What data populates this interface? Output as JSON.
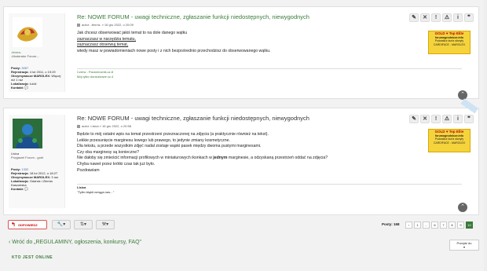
{
  "post1": {
    "user": "-fenrra-",
    "rank": "-Moderator Forum-..",
    "fields": [
      {
        "k": "Posty:",
        "v": "3057"
      },
      {
        "k": "Rejestracja:",
        "v": "4 lut 2011, o 19:29"
      },
      {
        "k": "Otrzymywacze MAROLEX:",
        "v": "Więcej niż 1 raz"
      },
      {
        "k": "Lokalizacja:",
        "v": "Łódź"
      },
      {
        "k": "Kontakt:",
        "v": ""
      }
    ],
    "title": "Re: NOWE FORUM - uwagi techniczne, zgłaszanie funkcji niedostępnych, niewygodnych",
    "meta": "autor: -fenrra- » 16 gru 2022, o 20:09",
    "body": [
      "Jak chcesz obserwować jakiś temat to na dole danego wątku",
      "zaznaczasz w narzędzia tematu,",
      "zaznaczasz obserwuj temat,",
      "wtedy masz w powiadomieniach nowe posty i z nich bezpośrednio przechodzisz do obserwowanego wątku."
    ],
    "sig": [
      "Czerw - Paciorecznik.cz.8",
      "Mój tylko doniczkowe cz.4"
    ]
  },
  "post2": {
    "user": "Lisica",
    "rank": "Przyjaciel Forum - gold",
    "fields": [
      {
        "k": "Posty:",
        "v": "1332"
      },
      {
        "k": "Rejestracja:",
        "v": "18 lut 2012, o 18:27"
      },
      {
        "k": "Otrzymywacze MAROLEX:",
        "v": "3 raz"
      },
      {
        "k": "Lokalizacja:",
        "v": "Gdańsk i Ziemia Kaszubska"
      },
      {
        "k": "Kontakt:",
        "v": ""
      }
    ],
    "title": "Re: NOWE FORUM - uwagi techniczne, zgłaszanie funkcji niedostępnych, niewygodnych",
    "meta": "autor: Lisica » 16 gru 2022, o 20:58",
    "body": [
      "Będzie to mój ostatni wpis na temat przestrzeni przeznaczonej na zdjęcia (a praktycznie również na tekst).",
      "Lekkie przesunięcie marginesu lewego lub prawego, to jedynie zmiany kosmetyczne.",
      "Dla tekstu, a przede wszystkim zdjęć nadal zostaje wąski pasek między dwoma pustymi marginesami.",
      "Czy oba marginesy są konieczne?",
      "Nie dałoby się zmieścić informacji profilowych w miniaturowych ikonkach w jednym marginesie, a odzyskaną przestrzeń oddać na zdjęcia?",
      "Chyba nawet przez krótki czas tak już było.",
      "Pozdrawiam"
    ],
    "sig_name": "Lisica",
    "sig_quote": "\"Tylko błąkit wciąga nas...\""
  },
  "banner": {
    "line1": "GOLD",
    "line2": "Top Elite",
    "line3": "forumogrodnicze.info",
    "line4": "Podwalicz kurtz słonyfy",
    "line5": "CARDIFACE - MAROLEX"
  },
  "toolbar": {
    "reply": "ODPOWIEDZ",
    "posts": "Posty: 168"
  },
  "pages": [
    "1",
    "...",
    "6",
    "7",
    "8",
    "9",
    "10"
  ],
  "back": "Wróć do „REGULAMINY, ogłoszenia, konkursy, FAQ\"",
  "jump": "Przejdź do",
  "who": "KTO JEST ONLINE"
}
